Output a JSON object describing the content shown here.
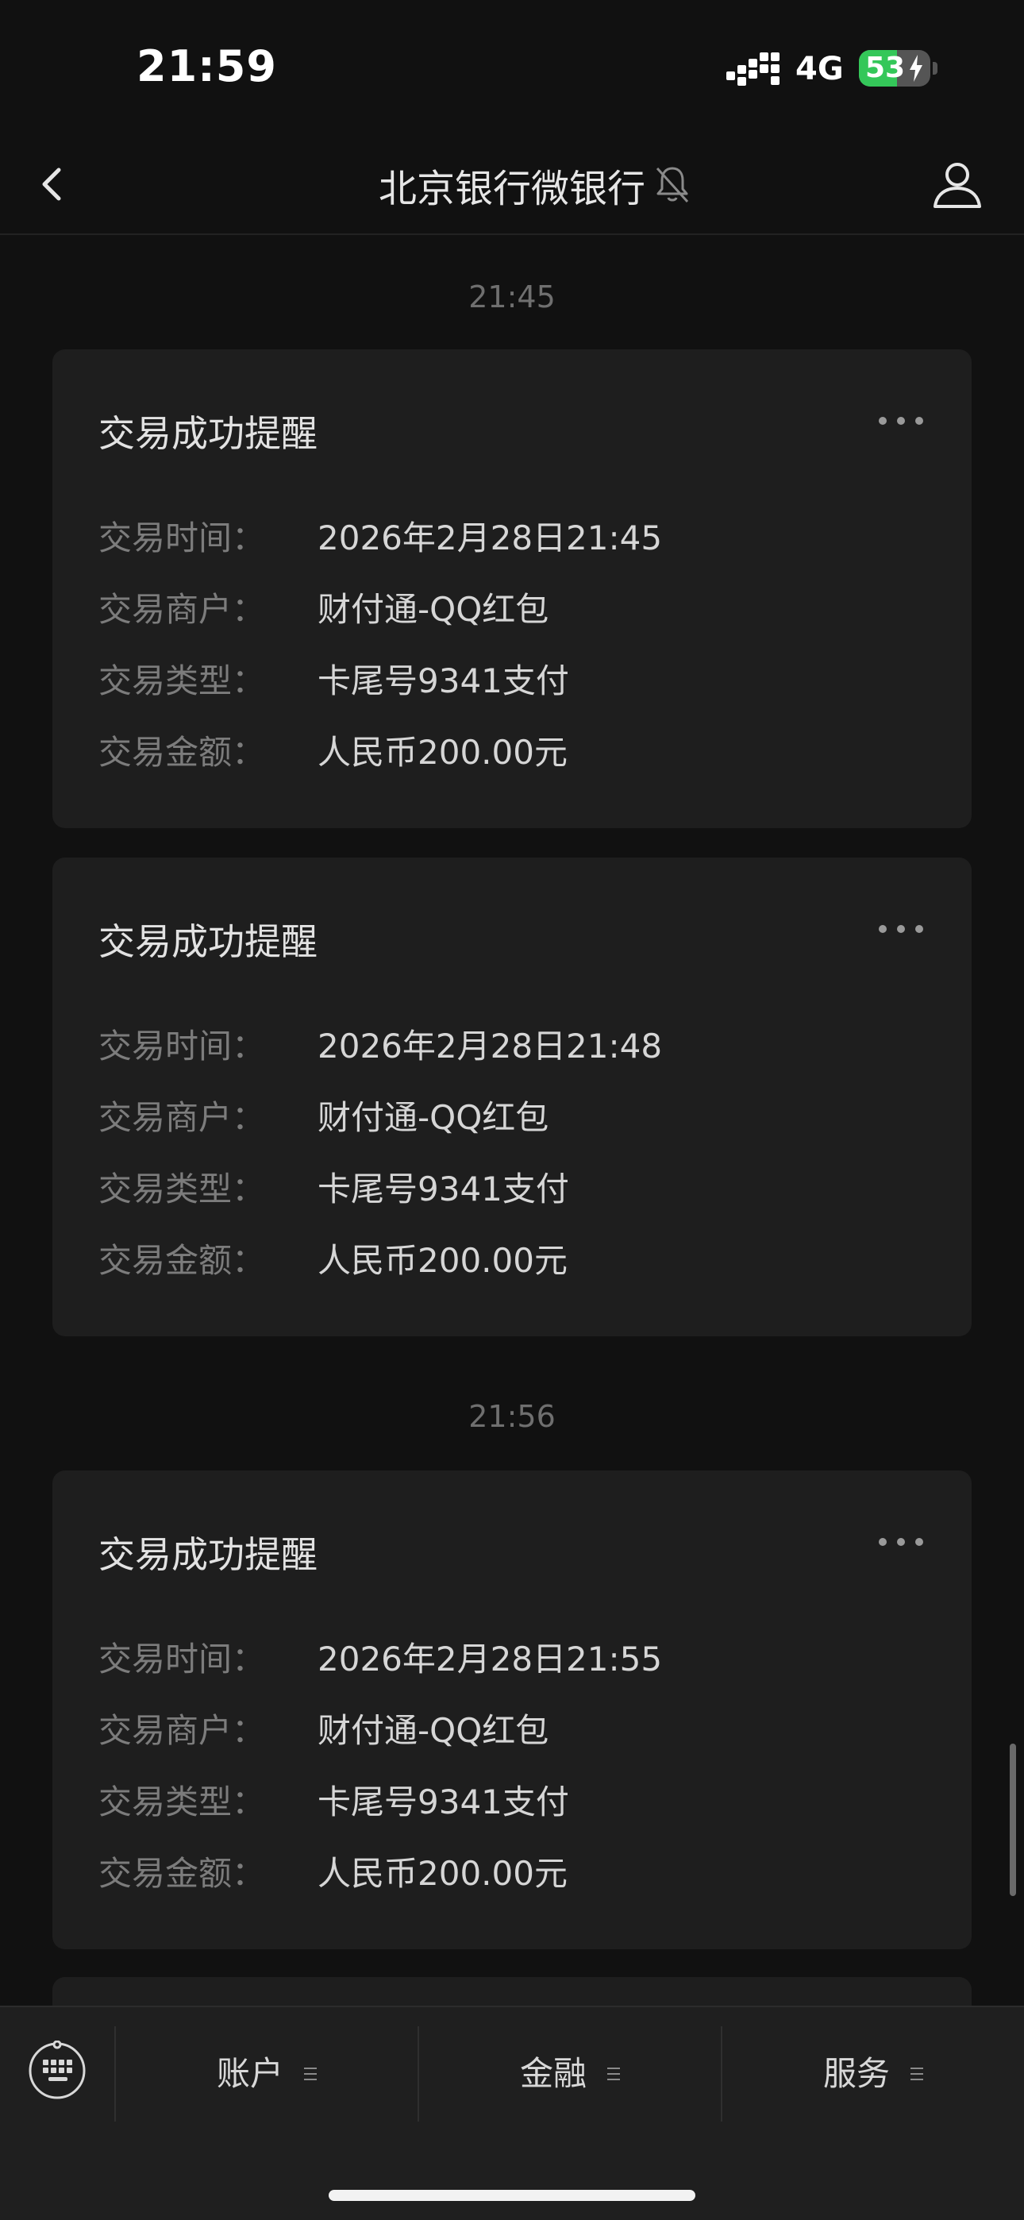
{
  "status_bar": {
    "time": "21:59",
    "network": "4G",
    "battery": "53",
    "battery_level_percent": 53
  },
  "nav": {
    "title": "北京银行微银行",
    "back_icon": "chevron-left-icon",
    "mute_icon": "bell-muted-icon",
    "profile_icon": "person-icon"
  },
  "timestamps": [
    "21:45",
    "21:56"
  ],
  "cards": [
    {
      "title": "交易成功提醒",
      "rows": [
        {
          "label": "交易时间：",
          "value": "2026年2月28日21:45"
        },
        {
          "label": "交易商户：",
          "value": "财付通-QQ红包"
        },
        {
          "label": "交易类型：",
          "value": "卡尾号9341支付"
        },
        {
          "label": "交易金额：",
          "value": "人民币200.00元"
        }
      ]
    },
    {
      "title": "交易成功提醒",
      "rows": [
        {
          "label": "交易时间：",
          "value": "2026年2月28日21:48"
        },
        {
          "label": "交易商户：",
          "value": "财付通-QQ红包"
        },
        {
          "label": "交易类型：",
          "value": "卡尾号9341支付"
        },
        {
          "label": "交易金额：",
          "value": "人民币200.00元"
        }
      ]
    },
    {
      "title": "交易成功提醒",
      "rows": [
        {
          "label": "交易时间：",
          "value": "2026年2月28日21:55"
        },
        {
          "label": "交易商户：",
          "value": "财付通-QQ红包"
        },
        {
          "label": "交易类型：",
          "value": "卡尾号9341支付"
        },
        {
          "label": "交易金额：",
          "value": "人民币200.00元"
        }
      ]
    }
  ],
  "bottom_menu": {
    "keyboard_icon": "keyboard-icon",
    "items": [
      {
        "label": "账户"
      },
      {
        "label": "金融"
      },
      {
        "label": "服务"
      }
    ]
  }
}
